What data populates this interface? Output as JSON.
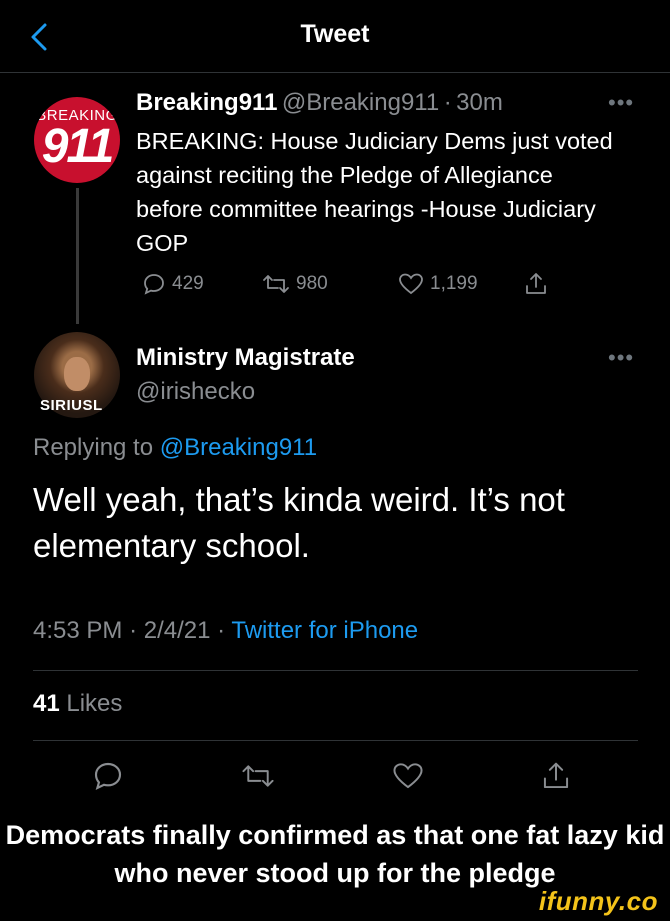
{
  "header": {
    "title": "Tweet"
  },
  "quoted": {
    "avatar_text_top": "BREAKING",
    "avatar_text_main": "911",
    "name": "Breaking911",
    "handle": "@Breaking911",
    "sep": "·",
    "time": "30m",
    "text": "BREAKING: House Judiciary Dems just voted against reciting the Pledge of Allegiance before committee hearings -House Judiciary GOP",
    "replies": "429",
    "retweets": "980",
    "likes": "1,199"
  },
  "reply_tweet": {
    "name": "Ministry Magistrate",
    "handle": "@irishecko",
    "avatar_caption": "SIRIUSL",
    "replying_to_label": "Replying to",
    "replying_to_handle": "@Breaking911",
    "text": "Well yeah, that’s kinda weird. It’s not elementary school.",
    "time": "4:53 PM",
    "date": "2/4/21",
    "source": "Twitter for iPhone",
    "likes_count": "41",
    "likes_label": "Likes"
  },
  "caption": "Democrats finally confirmed as that one fat lazy kid who never stood up for the pledge",
  "watermark": "ifunny.co",
  "colors": {
    "accent": "#1d9bf0",
    "muted": "#8a8d91",
    "divider": "#2f3336"
  }
}
